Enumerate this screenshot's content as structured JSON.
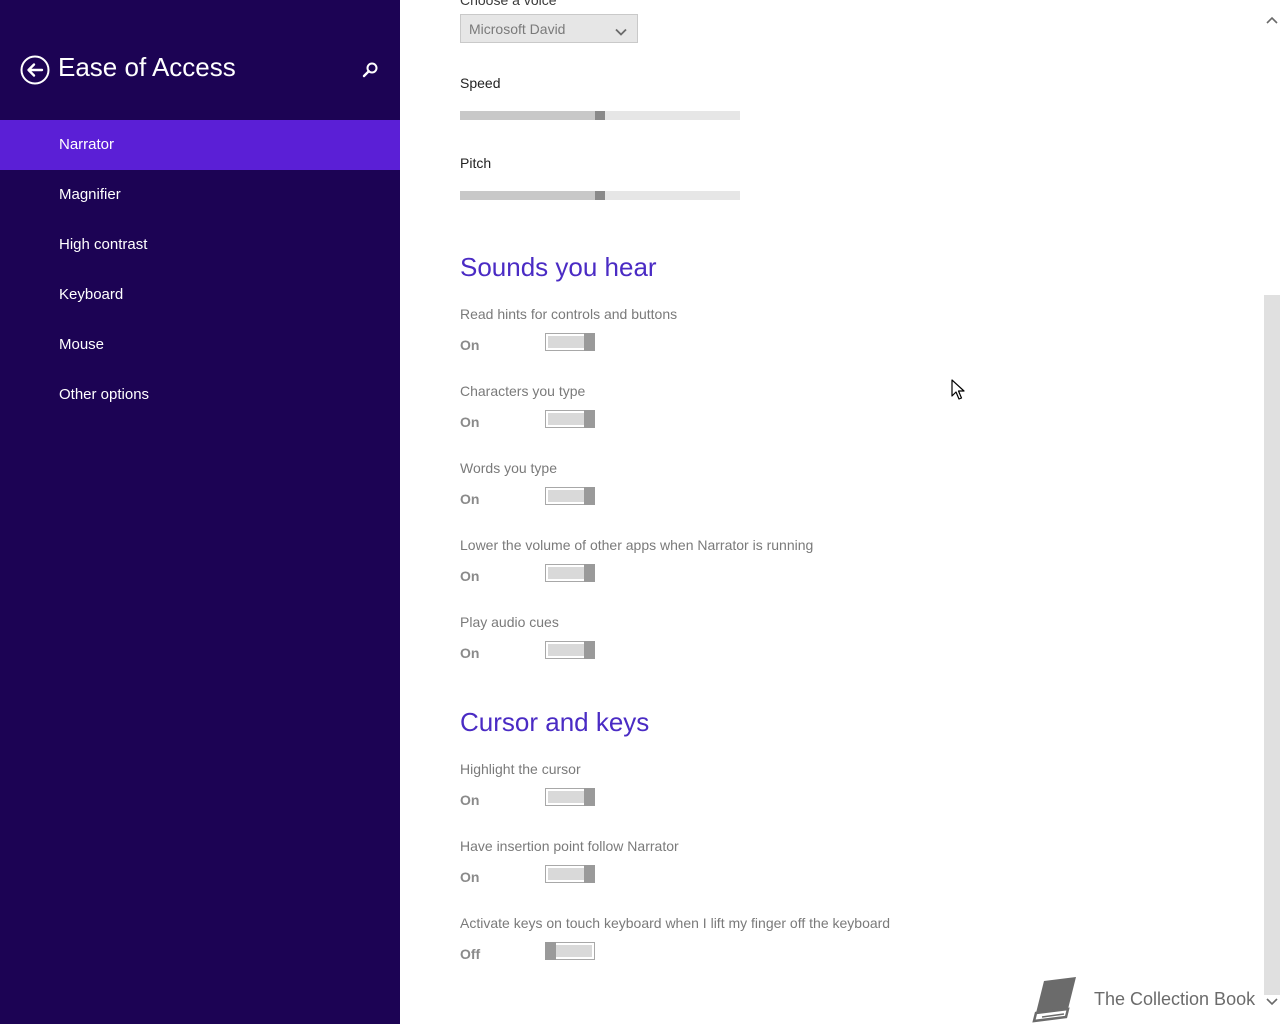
{
  "sidebar": {
    "title": "Ease of Access",
    "items": [
      {
        "label": "Narrator",
        "selected": true
      },
      {
        "label": "Magnifier",
        "selected": false
      },
      {
        "label": "High contrast",
        "selected": false
      },
      {
        "label": "Keyboard",
        "selected": false
      },
      {
        "label": "Mouse",
        "selected": false
      },
      {
        "label": "Other options",
        "selected": false
      }
    ],
    "colors": {
      "background": "#1c0354",
      "selected": "#5b1fd6"
    }
  },
  "voice": {
    "label": "Choose a voice",
    "value": "Microsoft David"
  },
  "speed": {
    "label": "Speed",
    "value_fraction": 0.5
  },
  "pitch": {
    "label": "Pitch",
    "value_fraction": 0.5
  },
  "sounds": {
    "heading": "Sounds you hear",
    "settings": [
      {
        "label": "Read hints for controls and buttons",
        "state": "On"
      },
      {
        "label": "Characters you type",
        "state": "On"
      },
      {
        "label": "Words you type",
        "state": "On"
      },
      {
        "label": "Lower the volume of other apps when Narrator is running",
        "state": "On"
      },
      {
        "label": "Play audio cues",
        "state": "On"
      }
    ]
  },
  "cursor_keys": {
    "heading": "Cursor and keys",
    "settings": [
      {
        "label": "Highlight the cursor",
        "state": "On"
      },
      {
        "label": "Have insertion point follow Narrator",
        "state": "On"
      },
      {
        "label": "Activate keys on touch keyboard when I lift my finger off the keyboard",
        "state": "Off"
      }
    ]
  },
  "watermark": {
    "text": "The Collection Book"
  },
  "icons": {
    "back": "back-arrow-icon",
    "search": "search-icon",
    "dropdown": "chevron-down-icon",
    "book": "book-icon"
  },
  "accent_color": "#4a2bc4"
}
